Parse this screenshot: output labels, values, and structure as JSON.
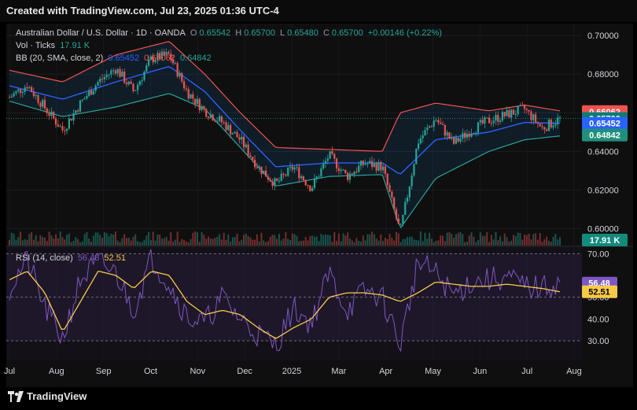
{
  "header": {
    "title": "Created with TradingView.com, Jul 23, 2025 01:36 UTC-4"
  },
  "footer": {
    "brand": "TradingView"
  },
  "legend": {
    "symbol": "Australian Dollar / U.S. Dollar · 1D · OANDA",
    "open_label": "O",
    "open": "0.65542",
    "high_label": "H",
    "high": "0.65700",
    "low_label": "L",
    "low": "0.65480",
    "close_label": "C",
    "close": "0.65700",
    "change": "+0.00146 (+0.22%)",
    "vol_label": "Vol · Ticks",
    "vol_value": "17.91 K",
    "bb_label": "BB (20, SMA, close, 2)",
    "bb_basis": "0.65452",
    "bb_upper": "0.66062",
    "bb_lower": "0.64842",
    "rsi_label": "RSI (14, close)",
    "rsi_value": "56.48",
    "rsi_ma": "52.51"
  },
  "price_badges": {
    "upper": "0.66062",
    "close": "0.65700",
    "basis": "0.65452",
    "lower": "0.64842",
    "volume": "17.91 K"
  },
  "rsi_badges": {
    "rsi": "56.48",
    "ma": "52.51"
  },
  "colors": {
    "up": "#26a69a",
    "down": "#ef5350",
    "bb_upper": "#ef5350",
    "bb_basis": "#2962ff",
    "bb_lower": "#26a69a",
    "rsi": "#7e57c2",
    "rsi_ma": "#f7c948"
  },
  "chart_data": [
    {
      "type": "line",
      "subtype": "candlestick",
      "title": "Australian Dollar / U.S. Dollar · 1D · OANDA",
      "x_months": [
        "Jul",
        "Aug",
        "Sep",
        "Oct",
        "Nov",
        "Dec",
        "2025",
        "Mar",
        "Apr",
        "May",
        "Jun",
        "Jul",
        "Aug"
      ],
      "y_ticks": [
        "0.70000",
        "0.68000",
        "0.66000",
        "0.64000",
        "0.62000",
        "0.60000"
      ],
      "ylim": [
        0.5912,
        0.7062
      ],
      "series": [
        {
          "name": "Price",
          "points": [
            [
              0,
              0.668
            ],
            [
              1,
              0.6745
            ],
            [
              2,
              0.6625
            ],
            [
              3,
              0.651
            ],
            [
              4,
              0.665
            ],
            [
              5,
              0.676
            ],
            [
              6,
              0.683
            ],
            [
              7,
              0.671
            ],
            [
              8,
              0.688
            ],
            [
              9,
              0.69
            ],
            [
              10,
              0.671
            ],
            [
              11,
              0.661
            ],
            [
              12,
              0.655
            ],
            [
              13,
              0.646
            ],
            [
              14,
              0.632
            ],
            [
              15,
              0.623
            ],
            [
              16,
              0.632
            ],
            [
              17,
              0.621
            ],
            [
              18,
              0.638
            ],
            [
              19,
              0.627
            ],
            [
              20,
              0.634
            ],
            [
              21,
              0.632
            ],
            [
              22,
              0.598
            ],
            [
              23,
              0.645
            ],
            [
              24,
              0.657
            ],
            [
              25,
              0.644
            ],
            [
              26,
              0.651
            ],
            [
              27,
              0.656
            ],
            [
              28,
              0.659
            ],
            [
              29,
              0.662
            ],
            [
              30,
              0.652
            ],
            [
              31,
              0.657
            ]
          ]
        },
        {
          "name": "BB Upper",
          "points": [
            [
              0,
              0.682
            ],
            [
              3,
              0.676
            ],
            [
              6,
              0.69
            ],
            [
              9,
              0.697
            ],
            [
              11,
              0.68
            ],
            [
              13,
              0.66
            ],
            [
              15,
              0.642
            ],
            [
              18,
              0.641
            ],
            [
              21,
              0.64
            ],
            [
              22,
              0.66
            ],
            [
              24,
              0.665
            ],
            [
              27,
              0.661
            ],
            [
              29,
              0.664
            ],
            [
              31,
              0.661
            ]
          ]
        },
        {
          "name": "BB Basis",
          "points": [
            [
              0,
              0.674
            ],
            [
              3,
              0.667
            ],
            [
              6,
              0.676
            ],
            [
              9,
              0.684
            ],
            [
              11,
              0.671
            ],
            [
              13,
              0.651
            ],
            [
              15,
              0.632
            ],
            [
              18,
              0.634
            ],
            [
              21,
              0.634
            ],
            [
              22,
              0.628
            ],
            [
              24,
              0.646
            ],
            [
              27,
              0.65
            ],
            [
              29,
              0.655
            ],
            [
              31,
              0.6545
            ]
          ]
        },
        {
          "name": "BB Lower",
          "points": [
            [
              0,
              0.666
            ],
            [
              3,
              0.658
            ],
            [
              6,
              0.663
            ],
            [
              9,
              0.67
            ],
            [
              11,
              0.662
            ],
            [
              13,
              0.642
            ],
            [
              15,
              0.622
            ],
            [
              18,
              0.627
            ],
            [
              21,
              0.628
            ],
            [
              22,
              0.6
            ],
            [
              24,
              0.626
            ],
            [
              27,
              0.64
            ],
            [
              29,
              0.646
            ],
            [
              31,
              0.648
            ]
          ]
        }
      ]
    },
    {
      "type": "line",
      "title": "RSI (14, close)",
      "y_ticks": [
        "70.00",
        "50.00",
        "40.00",
        "30.00"
      ],
      "levels": [
        30,
        50,
        70
      ],
      "ylim": [
        21,
        73
      ],
      "series": [
        {
          "name": "RSI",
          "points": [
            [
              0,
              54
            ],
            [
              1,
              67
            ],
            [
              2,
              45
            ],
            [
              3,
              31
            ],
            [
              4,
              58
            ],
            [
              5,
              66
            ],
            [
              6,
              61
            ],
            [
              7,
              44
            ],
            [
              8,
              68
            ],
            [
              9,
              56
            ],
            [
              10,
              41
            ],
            [
              11,
              38
            ],
            [
              12,
              50
            ],
            [
              13,
              40
            ],
            [
              14,
              33
            ],
            [
              15,
              28
            ],
            [
              16,
              45
            ],
            [
              17,
              38
            ],
            [
              18,
              61
            ],
            [
              19,
              44
            ],
            [
              20,
              53
            ],
            [
              21,
              50
            ],
            [
              22,
              28
            ],
            [
              23,
              66
            ],
            [
              24,
              61
            ],
            [
              25,
              51
            ],
            [
              26,
              57
            ],
            [
              27,
              58
            ],
            [
              28,
              59
            ],
            [
              29,
              55
            ],
            [
              30,
              54
            ],
            [
              31,
              56.5
            ]
          ]
        },
        {
          "name": "RSI MA",
          "points": [
            [
              0,
              58
            ],
            [
              1,
              62
            ],
            [
              2,
              52
            ],
            [
              3,
              34
            ],
            [
              4,
              48
            ],
            [
              5,
              62
            ],
            [
              6,
              60
            ],
            [
              7,
              54
            ],
            [
              8,
              62
            ],
            [
              9,
              60
            ],
            [
              10,
              48
            ],
            [
              11,
              42
            ],
            [
              12,
              44
            ],
            [
              13,
              42
            ],
            [
              14,
              36
            ],
            [
              15,
              31
            ],
            [
              16,
              36
            ],
            [
              17,
              40
            ],
            [
              18,
              50
            ],
            [
              19,
              52
            ],
            [
              20,
              52
            ],
            [
              21,
              51
            ],
            [
              22,
              48
            ],
            [
              23,
              52
            ],
            [
              24,
              57
            ],
            [
              25,
              56
            ],
            [
              26,
              55
            ],
            [
              27,
              55
            ],
            [
              28,
              56
            ],
            [
              29,
              55
            ],
            [
              30,
              54
            ],
            [
              31,
              52.5
            ]
          ]
        }
      ]
    }
  ]
}
